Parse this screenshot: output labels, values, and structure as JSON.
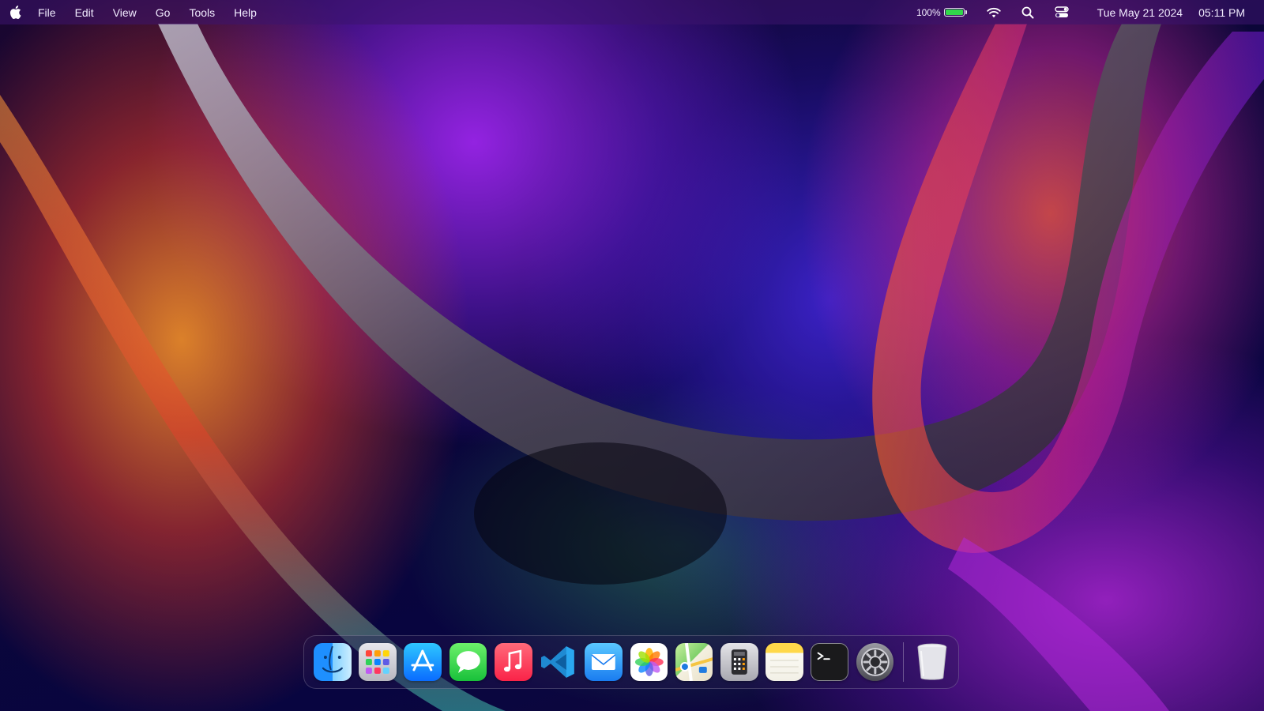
{
  "menubar": {
    "menus": [
      "File",
      "Edit",
      "View",
      "Go",
      "Tools",
      "Help"
    ],
    "battery_percent": "100%",
    "battery_level": 1.0,
    "date": "Tue May 21 2024",
    "time": "05:11 PM",
    "icons": [
      "apple-icon",
      "battery-icon",
      "wifi-icon",
      "search-icon",
      "control-center-icon"
    ]
  },
  "dock": {
    "apps": [
      "Finder",
      "Launchpad",
      "App Store",
      "Messages",
      "Music",
      "Visual Studio Code",
      "Mail",
      "Photos",
      "Maps",
      "Calculator",
      "Notes",
      "Terminal",
      "System Settings"
    ],
    "trash": "Trash"
  },
  "colors": {
    "battery_green": "#32d74b",
    "menubar_bg": "#3c146e"
  }
}
